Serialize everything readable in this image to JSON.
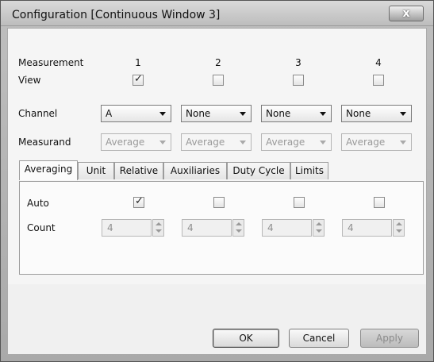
{
  "window": {
    "title": "Configuration [Continuous Window 3]",
    "close_glyph": "x"
  },
  "header": {
    "measurement_label": "Measurement",
    "view_label": "View",
    "columns": [
      "1",
      "2",
      "3",
      "4"
    ],
    "view_checked": [
      true,
      false,
      false,
      false
    ]
  },
  "channel": {
    "label": "Channel",
    "values": [
      "A",
      "None",
      "None",
      "None"
    ]
  },
  "measurand": {
    "label": "Measurand",
    "values": [
      "Average",
      "Average",
      "Average",
      "Average"
    ]
  },
  "tabs": [
    {
      "label": "Averaging",
      "active": true
    },
    {
      "label": "Unit",
      "active": false
    },
    {
      "label": "Relative",
      "active": false
    },
    {
      "label": "Auxiliaries",
      "active": false
    },
    {
      "label": "Duty Cycle",
      "active": false
    },
    {
      "label": "Limits",
      "active": false
    }
  ],
  "averaging": {
    "auto_label": "Auto",
    "auto_checked": [
      true,
      false,
      false,
      false
    ],
    "count_label": "Count",
    "count_values": [
      "4",
      "4",
      "4",
      "4"
    ]
  },
  "buttons": {
    "ok": "OK",
    "cancel": "Cancel",
    "apply": "Apply"
  },
  "icons": {
    "check": "check-icon",
    "dropdown": "chevron-down-icon",
    "spin": "spin-arrows-icon",
    "close": "close-icon"
  }
}
